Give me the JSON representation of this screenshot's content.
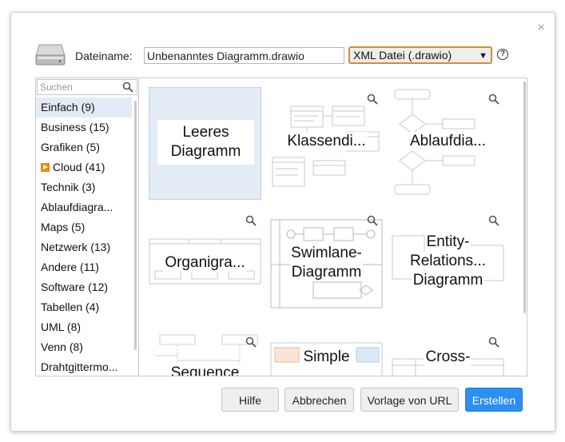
{
  "dialog": {
    "close_label": "×",
    "filename_label": "Dateiname:",
    "filename_value": "Unbenanntes Diagramm.drawio",
    "format_value": "XML Datei (.drawio)",
    "help_label": "?"
  },
  "sidebar": {
    "search_placeholder": "Suchen",
    "categories": [
      {
        "label": "Einfach (9)"
      },
      {
        "label": "Business (15)"
      },
      {
        "label": "Grafiken (5)"
      },
      {
        "label": "Cloud (41)"
      },
      {
        "label": "Technik (3)"
      },
      {
        "label": "Ablaufdiagra..."
      },
      {
        "label": "Maps (5)"
      },
      {
        "label": "Netzwerk (13)"
      },
      {
        "label": "Andere (11)"
      },
      {
        "label": "Software (12)"
      },
      {
        "label": "Tabellen (4)"
      },
      {
        "label": "UML (8)"
      },
      {
        "label": "Venn (8)"
      },
      {
        "label": "Drahtgittermo..."
      }
    ]
  },
  "templates": {
    "blank": {
      "line1": "Leeres",
      "line2": "Diagramm"
    },
    "tiles": [
      {
        "label": "Klassendi..."
      },
      {
        "label": "Ablaufdia..."
      },
      {
        "label": "Organigra..."
      },
      {
        "line1": "Swimlane-",
        "line2": "Diagramm"
      },
      {
        "line1": "Entity-",
        "line2": "Relations...",
        "line3": "Diagramm"
      },
      {
        "label": "Sequence"
      },
      {
        "label": "Simple"
      },
      {
        "label": "Cross-"
      }
    ]
  },
  "buttons": {
    "help": "Hilfe",
    "cancel": "Abbrechen",
    "url": "Vorlage von URL",
    "create": "Erstellen"
  }
}
